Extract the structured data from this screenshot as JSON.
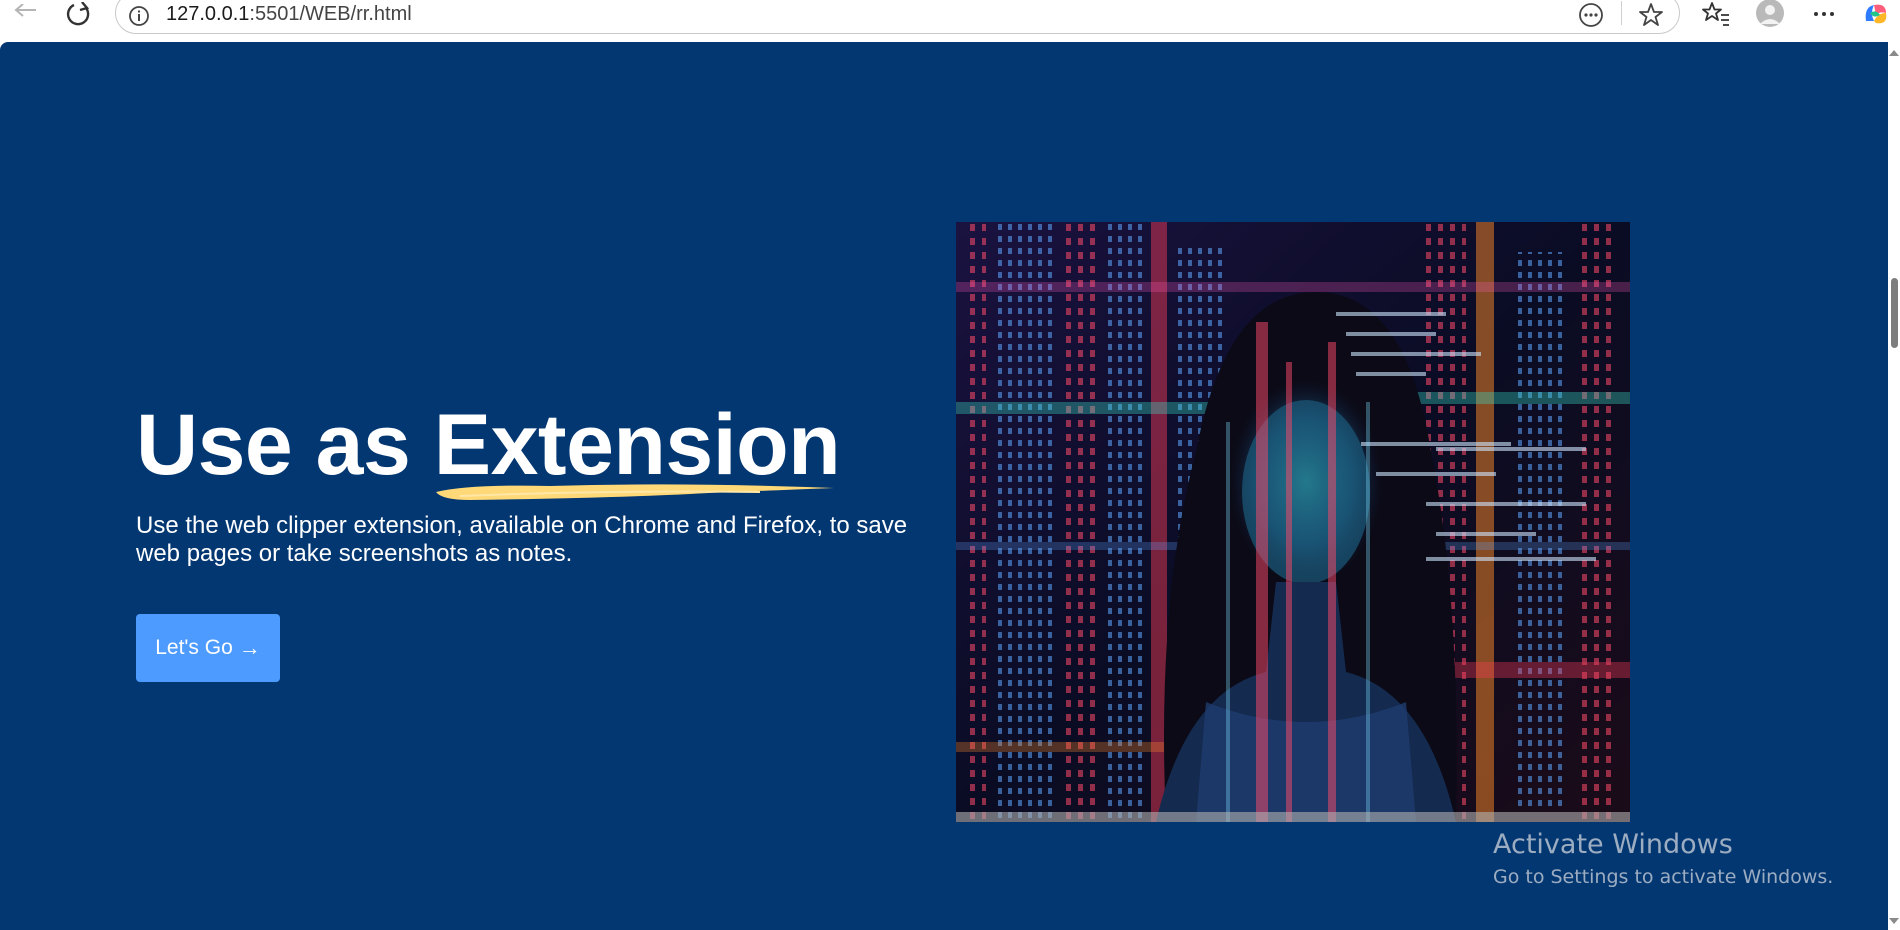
{
  "browser": {
    "url_host": "127.0.0.1",
    "url_path": ":5501/WEB/rr.html",
    "icons": {
      "back": "back-arrow-icon",
      "refresh": "refresh-icon",
      "site_info": "info-icon",
      "read_aloud": "ellipsis-circle-icon",
      "favorite": "star-icon",
      "favorites_bar": "favorites-icon",
      "profile": "avatar-icon",
      "menu": "more-icon",
      "copilot": "copilot-icon"
    }
  },
  "hero": {
    "title_prefix": "Use as",
    "title_highlight": "Extension",
    "subtitle": "Use the web clipper extension, available on Chrome and Firefox, to save web pages or take screenshots as notes.",
    "cta_label": "Let's Go",
    "cta_arrow": "→",
    "image_alt": "Woman with projected code lights"
  },
  "watermark": {
    "title": "Activate Windows",
    "subtitle": "Go to Settings to activate Windows."
  },
  "colors": {
    "background": "#033772",
    "accent_button": "#4e9bff",
    "highlight_brush": "#ffd877",
    "text": "#ffffff"
  }
}
